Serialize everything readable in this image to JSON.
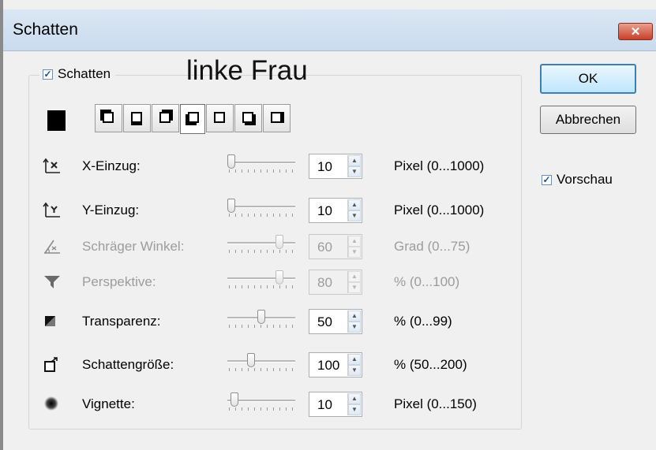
{
  "window": {
    "title": "Schatten",
    "close_glyph": "✕"
  },
  "annotation": "linke Frau",
  "shadow_checkbox": {
    "label": "Schatten",
    "checked": true
  },
  "shadow_color": "#000000",
  "shadow_type_buttons": [
    {
      "icon": "shadow-type-1-icon",
      "active": false
    },
    {
      "icon": "shadow-type-2-icon",
      "active": false
    },
    {
      "icon": "shadow-type-3-icon",
      "active": false
    },
    {
      "icon": "shadow-type-4-icon",
      "active": true
    },
    {
      "icon": "shadow-type-5-icon",
      "active": false
    },
    {
      "icon": "shadow-type-6-icon",
      "active": false
    },
    {
      "icon": "shadow-type-7-icon",
      "active": false
    }
  ],
  "params": [
    {
      "id": "x-offset",
      "icon": "x-offset-icon",
      "label": "X-Einzug:",
      "value": "10",
      "range": "Pixel (0...1000)",
      "enabled": true,
      "level": 0.01
    },
    {
      "id": "y-offset",
      "icon": "y-offset-icon",
      "label": "Y-Einzug:",
      "value": "10",
      "range": "Pixel (0...1000)",
      "enabled": true,
      "level": 0.01
    },
    {
      "id": "skew-angle",
      "icon": "angle-icon",
      "label": "Schräger Winkel:",
      "value": "60",
      "range": "Grad (0...75)",
      "enabled": false,
      "level": 0.8
    },
    {
      "id": "perspective",
      "icon": "perspective-icon",
      "label": "Perspektive:",
      "value": "80",
      "range": "% (0...100)",
      "enabled": false,
      "level": 0.8
    },
    {
      "id": "transparency",
      "icon": "transparency-icon",
      "label": "Transparenz:",
      "value": "50",
      "range": "% (0...99)",
      "enabled": true,
      "level": 0.505
    },
    {
      "id": "shadow-size",
      "icon": "shadow-size-icon",
      "label": "Schattengröße:",
      "value": "100",
      "range": "% (50...200)",
      "enabled": true,
      "level": 0.333
    },
    {
      "id": "vignette",
      "icon": "vignette-icon",
      "label": "Vignette:",
      "value": "10",
      "range": "Pixel (0...150)",
      "enabled": true,
      "level": 0.067
    }
  ],
  "buttons": {
    "ok": "OK",
    "cancel": "Abbrechen"
  },
  "preview_checkbox": {
    "label": "Vorschau",
    "checked": true
  },
  "checkmark": "✓",
  "spin_up": "▲",
  "spin_down": "▼"
}
